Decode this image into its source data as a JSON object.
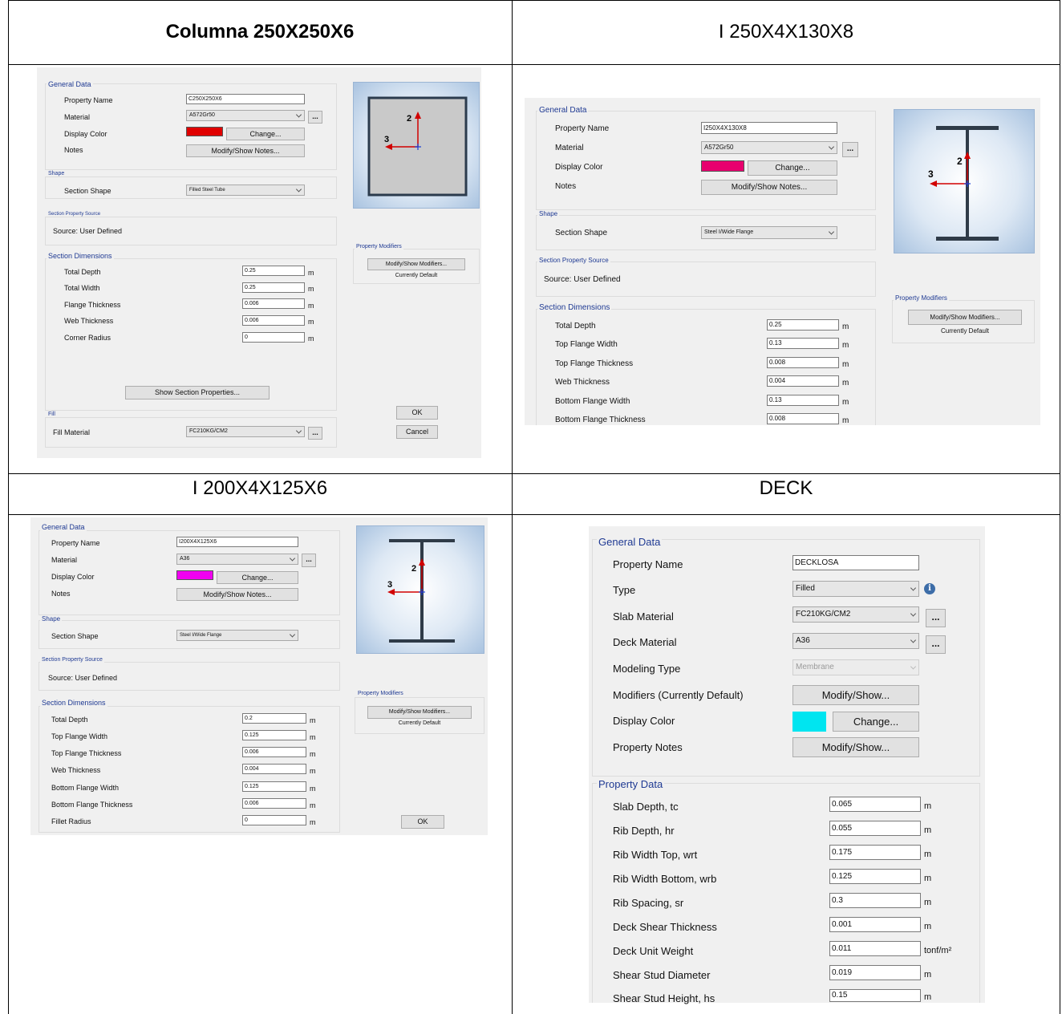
{
  "captions": {
    "col_tube": "Columna 250X250X6",
    "beam_250": "I 250X4X130X8",
    "beam_200": "I 200X4X125X6",
    "deck": "DECK"
  },
  "common": {
    "general_data": "General Data",
    "property_name": "Property Name",
    "material": "Material",
    "display_color": "Display Color",
    "notes": "Notes",
    "change": "Change...",
    "modify_show_notes": "Modify/Show Notes...",
    "shape": "Shape",
    "section_shape": "Section Shape",
    "section_property_source": "Section Property Source",
    "source": "Source:  User Defined",
    "section_dimensions": "Section Dimensions",
    "property_modifiers": "Property Modifiers",
    "modify_show_modifiers": "Modify/Show Modifiers...",
    "currently_default": "Currently Default",
    "ok": "OK",
    "cancel": "Cancel",
    "ellipsis": "...",
    "unit_m": "m",
    "axis_2": "2",
    "axis_3": "3"
  },
  "panel_tube": {
    "property_name_value": "C250X250X6",
    "material_value": "A572Gr50",
    "display_color_hex": "#e00000",
    "section_shape_value": "Filled Steel Tube",
    "dimensions": [
      {
        "label": "Total Depth",
        "value": "0.25"
      },
      {
        "label": "Total Width",
        "value": "0.25"
      },
      {
        "label": "Flange Thickness",
        "value": "0.006"
      },
      {
        "label": "Web Thickness",
        "value": "0.006"
      },
      {
        "label": "Corner Radius",
        "value": "0"
      }
    ],
    "show_section_properties": "Show Section Properties...",
    "fill": "Fill",
    "fill_material": "Fill Material",
    "fill_material_value": "FC210KG/CM2"
  },
  "panel_i250": {
    "property_name_value": "I250X4X130X8",
    "material_value": "A572Gr50",
    "display_color_hex": "#e8006e",
    "section_shape_value": "Steel I/Wide Flange",
    "dimensions": [
      {
        "label": "Total Depth",
        "value": "0.25"
      },
      {
        "label": "Top Flange Width",
        "value": "0.13"
      },
      {
        "label": "Top Flange Thickness",
        "value": "0.008"
      },
      {
        "label": "Web Thickness",
        "value": "0.004"
      },
      {
        "label": "Bottom Flange Width",
        "value": "0.13"
      },
      {
        "label": "Bottom Flange Thickness",
        "value": "0.008"
      }
    ]
  },
  "panel_i200": {
    "property_name_value": "I200X4X125X6",
    "material_value": "A36",
    "display_color_hex": "#f000f0",
    "section_shape_value": "Steel I/Wide Flange",
    "dimensions": [
      {
        "label": "Total Depth",
        "value": "0.2"
      },
      {
        "label": "Top Flange Width",
        "value": "0.125"
      },
      {
        "label": "Top Flange Thickness",
        "value": "0.006"
      },
      {
        "label": "Web Thickness",
        "value": "0.004"
      },
      {
        "label": "Bottom Flange Width",
        "value": "0.125"
      },
      {
        "label": "Bottom Flange Thickness",
        "value": "0.006"
      },
      {
        "label": "Fillet Radius",
        "value": "0"
      }
    ]
  },
  "panel_deck": {
    "general_data": "General Data",
    "property_name_value": "DECKLOSA",
    "type_label": "Type",
    "type_value": "Filled",
    "slab_material_label": "Slab Material",
    "slab_material_value": "FC210KG/CM2",
    "deck_material_label": "Deck Material",
    "deck_material_value": "A36",
    "modeling_type_label": "Modeling Type",
    "modeling_type_value": "Membrane",
    "modifiers_label": "Modifiers (Currently Default)",
    "modify_show": "Modify/Show...",
    "display_color_hex": "#00e5f0",
    "property_notes_label": "Property Notes",
    "property_data": "Property Data",
    "unit_tonf": "tonf/m²",
    "properties": [
      {
        "label": "Slab Depth, tc",
        "value": "0.065",
        "unit": "m"
      },
      {
        "label": "Rib Depth, hr",
        "value": "0.055",
        "unit": "m"
      },
      {
        "label": "Rib Width Top, wrt",
        "value": "0.175",
        "unit": "m"
      },
      {
        "label": "Rib Width Bottom, wrb",
        "value": "0.125",
        "unit": "m"
      },
      {
        "label": "Rib Spacing, sr",
        "value": "0.3",
        "unit": "m"
      },
      {
        "label": "Deck Shear Thickness",
        "value": "0.001",
        "unit": "m"
      },
      {
        "label": "Deck Unit Weight",
        "value": "0.011",
        "unit": "tonf/m²"
      },
      {
        "label": "Shear Stud Diameter",
        "value": "0.019",
        "unit": "m"
      },
      {
        "label": "Shear Stud Height, hs",
        "value": "0.15",
        "unit": "m"
      }
    ]
  }
}
